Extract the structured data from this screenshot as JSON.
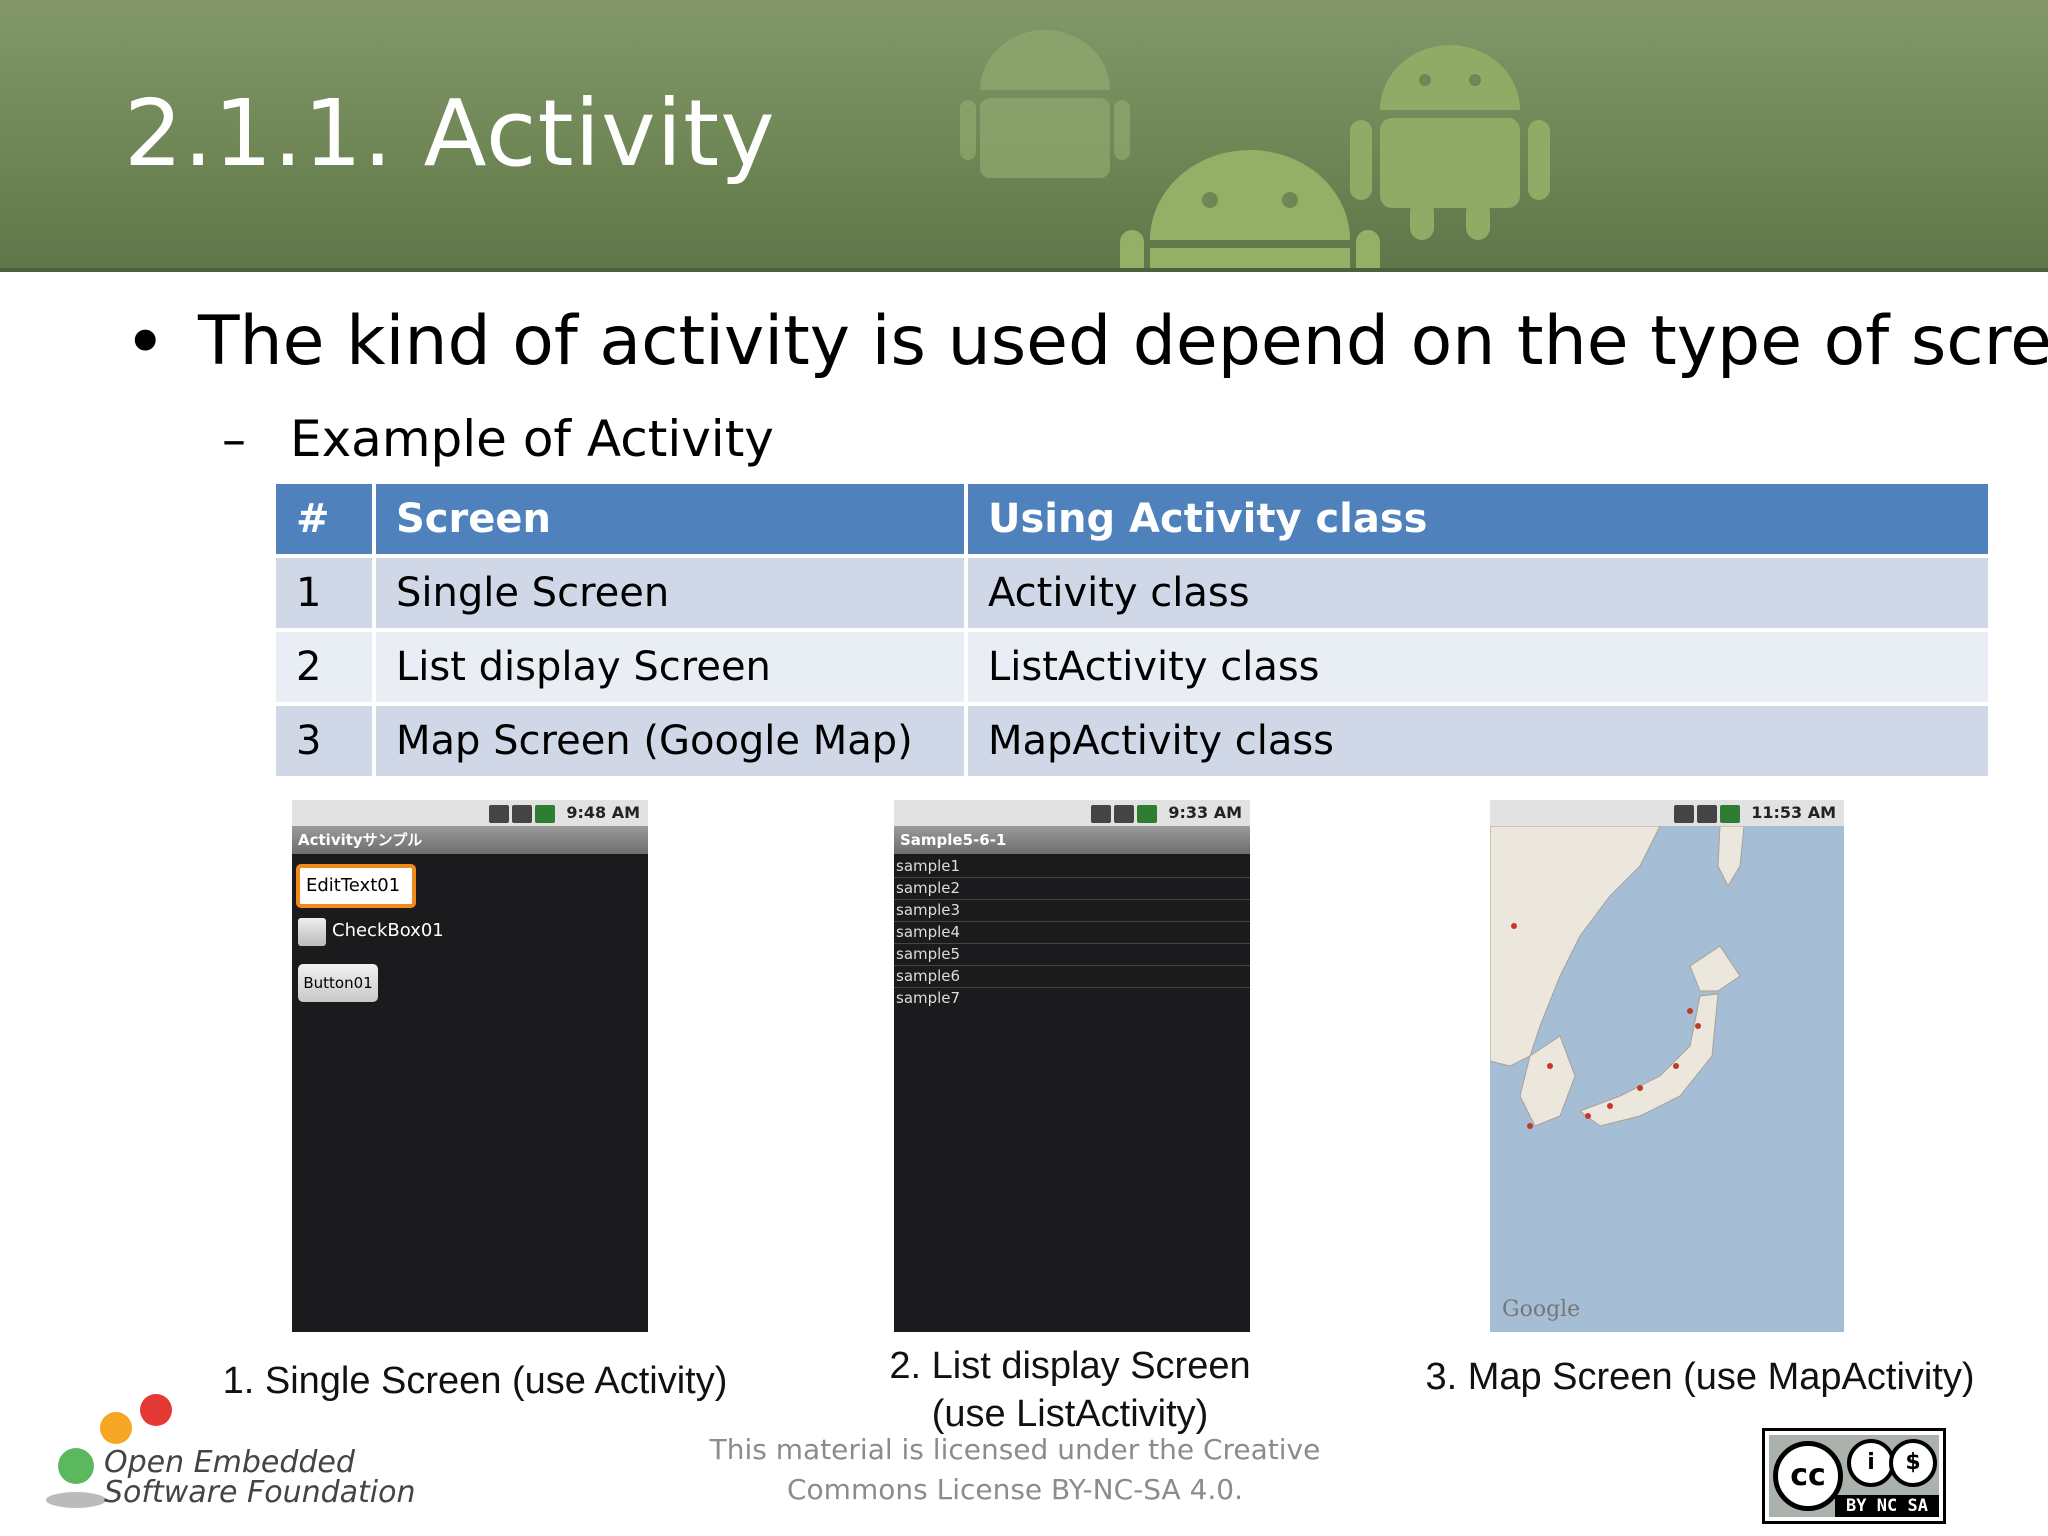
{
  "slide": {
    "title": "2.1.1. Activity",
    "bullet": "The kind of activity is used depend on the type of screen",
    "sub_bullet": "Example of Activity"
  },
  "table": {
    "headers": [
      "#",
      "Screen",
      "Using Activity class"
    ],
    "rows": [
      [
        "1",
        "Single Screen",
        "Activity class"
      ],
      [
        "2",
        "List display Screen",
        "ListActivity class"
      ],
      [
        "3",
        "Map Screen (Google Map)",
        "MapActivity class"
      ]
    ]
  },
  "phones": {
    "single": {
      "time": "9:48 AM",
      "title": "Activityサンプル",
      "edittext": "EditText01",
      "checkbox": "CheckBox01",
      "button": "Button01"
    },
    "list": {
      "time": "9:33 AM",
      "title": "Sample5-6-1",
      "items": [
        "sample1",
        "sample2",
        "sample3",
        "sample4",
        "sample5",
        "sample6",
        "sample7"
      ]
    },
    "map": {
      "time": "11:53 AM",
      "watermark": "Google"
    }
  },
  "captions": {
    "c1": "1. Single Screen (use Activity)",
    "c2_line1": "2. List display Screen",
    "c2_line2": "(use ListActivity)",
    "c3": "3. Map Screen (use MapActivity)"
  },
  "footer": {
    "license_line1": "This material is licensed under the Creative",
    "license_line2": "Commons License BY-NC-SA 4.0.",
    "logo_line1": "Open Embedded",
    "logo_line2": "Software Foundation",
    "cc_labels": "BY  NC  SA"
  },
  "colors": {
    "header_green": "#6f8655",
    "table_header": "#4f81bd",
    "row_dark": "#d0d8e8",
    "row_light": "#e9edf4"
  }
}
